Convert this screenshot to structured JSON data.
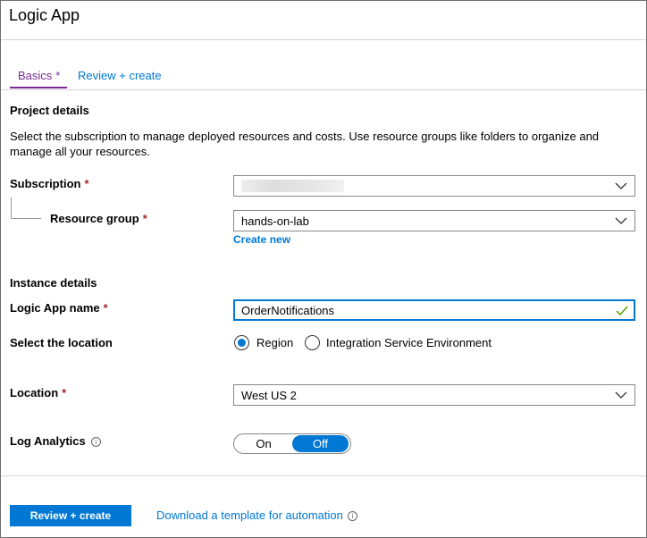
{
  "window": {
    "title": "Logic App"
  },
  "tabs": [
    {
      "label": "Basics",
      "required_mark": "*",
      "active": true
    },
    {
      "label": "Review + create",
      "active": false
    }
  ],
  "project_details": {
    "heading": "Project details",
    "description": "Select the subscription to manage deployed resources and costs. Use resource groups like folders to organize and manage all your resources.",
    "subscription": {
      "label": "Subscription",
      "required_mark": "*",
      "value": ""
    },
    "resource_group": {
      "label": "Resource group",
      "required_mark": "*",
      "value": "hands-on-lab",
      "create_new": "Create new"
    }
  },
  "instance_details": {
    "heading": "Instance details",
    "logic_app_name": {
      "label": "Logic App name",
      "required_mark": "*",
      "value": "OrderNotifications",
      "valid": true
    },
    "location_type": {
      "label": "Select the location",
      "options": [
        "Region",
        "Integration Service Environment"
      ],
      "selected": "Region"
    },
    "location": {
      "label": "Location",
      "required_mark": "*",
      "value": "West US 2"
    },
    "log_analytics": {
      "label": "Log Analytics",
      "info_icon": "info-icon",
      "on_label": "On",
      "off_label": "Off",
      "selected": "Off"
    }
  },
  "footer": {
    "primary_button": "Review + create",
    "download_link": "Download a template for automation"
  },
  "colors": {
    "accent": "#0078d4",
    "tab_active": "#7a2a91",
    "required": "#a4262c",
    "valid_check": "#57a300"
  }
}
